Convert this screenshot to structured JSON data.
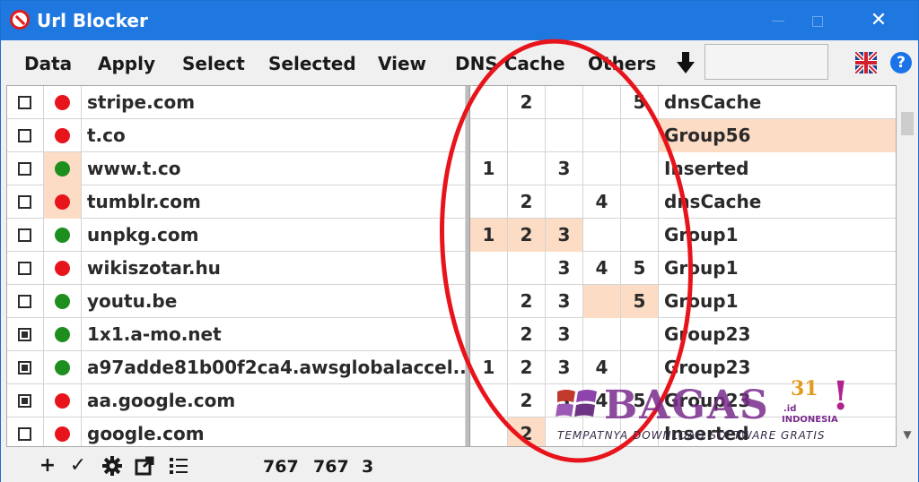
{
  "window": {
    "title": "Url Blocker",
    "close_glyph": "✕"
  },
  "menu": {
    "items": [
      "Data",
      "Apply",
      "Select",
      "Selected",
      "View",
      "DNS Cache",
      "Others"
    ],
    "search_value": "",
    "help_glyph": "?"
  },
  "table": {
    "rows": [
      {
        "checked": false,
        "status": "red",
        "domain": "stripe.com",
        "n": [
          "",
          "2",
          "",
          "",
          "5"
        ],
        "group": "dnsCache",
        "hl_n": [],
        "hl_group": false,
        "hl_dot": false
      },
      {
        "checked": false,
        "status": "red",
        "domain": "t.co",
        "n": [
          "",
          "",
          "",
          "",
          ""
        ],
        "group": "Group56",
        "hl_n": [],
        "hl_group": true,
        "hl_dot": false
      },
      {
        "checked": false,
        "status": "green",
        "domain": "www.t.co",
        "n": [
          "1",
          "",
          "3",
          "",
          ""
        ],
        "group": "Inserted",
        "hl_n": [],
        "hl_group": false,
        "hl_dot": true
      },
      {
        "checked": false,
        "status": "red",
        "domain": "tumblr.com",
        "n": [
          "",
          "2",
          "",
          "4",
          ""
        ],
        "group": "dnsCache",
        "hl_n": [],
        "hl_group": false,
        "hl_dot": true
      },
      {
        "checked": false,
        "status": "green",
        "domain": "unpkg.com",
        "n": [
          "1",
          "2",
          "3",
          "",
          ""
        ],
        "group": "Group1",
        "hl_n": [
          0,
          1,
          2
        ],
        "hl_group": false,
        "hl_dot": false
      },
      {
        "checked": false,
        "status": "red",
        "domain": "wikiszotar.hu",
        "n": [
          "",
          "",
          "3",
          "4",
          "5"
        ],
        "group": "Group1",
        "hl_n": [],
        "hl_group": false,
        "hl_dot": false
      },
      {
        "checked": false,
        "status": "green",
        "domain": "youtu.be",
        "n": [
          "",
          "2",
          "3",
          "",
          "5"
        ],
        "group": "Group1",
        "hl_n": [
          3,
          4
        ],
        "hl_group": false,
        "hl_dot": false
      },
      {
        "checked": true,
        "status": "green",
        "domain": "1x1.a-mo.net",
        "n": [
          "",
          "2",
          "3",
          "",
          ""
        ],
        "group": "Group23",
        "hl_n": [],
        "hl_group": false,
        "hl_dot": false
      },
      {
        "checked": true,
        "status": "green",
        "domain": "a97adde81b00f2ca4.awsglobalaccel...",
        "n": [
          "1",
          "2",
          "3",
          "4",
          ""
        ],
        "group": "Group23",
        "hl_n": [],
        "hl_group": false,
        "hl_dot": false
      },
      {
        "checked": true,
        "status": "red",
        "domain": "aa.google.com",
        "n": [
          "",
          "2",
          "3",
          "4",
          "5"
        ],
        "group": "Group23",
        "hl_n": [],
        "hl_group": false,
        "hl_dot": false
      },
      {
        "checked": false,
        "status": "red",
        "domain": "google.com",
        "n": [
          "",
          "2",
          "",
          "",
          ""
        ],
        "group": "Inserted",
        "hl_n": [
          1
        ],
        "hl_group": false,
        "hl_dot": false
      }
    ]
  },
  "statusbar": {
    "icons": [
      "+",
      "✓"
    ],
    "counts": [
      "767",
      "767",
      "3"
    ]
  },
  "colors": {
    "red": "#e8141b",
    "green": "#1e8f1e",
    "highlight": "#fcdcc4",
    "title_bar": "#1f78e0"
  },
  "watermark": {
    "name": "BAGAS",
    "number": "31",
    "id_suffix": ".id",
    "country": "INDONESIA",
    "mark": "!",
    "tagline": "TEMPATNYA DOWNLOAD SOFTWARE GRATIS"
  }
}
